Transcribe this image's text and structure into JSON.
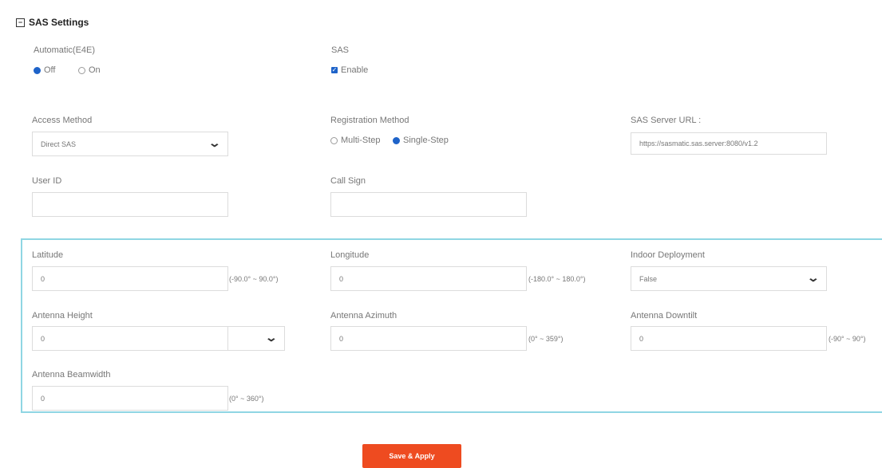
{
  "section": {
    "title": "SAS Settings"
  },
  "automatic": {
    "label": "Automatic(E4E)",
    "off": "Off",
    "on": "On",
    "selected": "Off"
  },
  "sas": {
    "label": "SAS",
    "enable_label": "Enable",
    "checked": true
  },
  "access_method": {
    "label": "Access Method",
    "value": "Direct SAS"
  },
  "registration_method": {
    "label": "Registration Method",
    "multi": "Multi-Step",
    "single": "Single-Step",
    "selected": "Single-Step"
  },
  "sas_server_url": {
    "label": "SAS Server URL :",
    "value": "https://sasmatic.sas.server:8080/v1.2"
  },
  "user_id": {
    "label": "User ID",
    "value": ""
  },
  "call_sign": {
    "label": "Call Sign",
    "value": ""
  },
  "latitude": {
    "label": "Latitude",
    "value": "0",
    "range": "(-90.0° ~ 90.0°)"
  },
  "longitude": {
    "label": "Longitude",
    "value": "0",
    "range": "(-180.0° ~ 180.0°)"
  },
  "indoor_deployment": {
    "label": "Indoor Deployment",
    "value": "False"
  },
  "antenna_height": {
    "label": "Antenna Height",
    "value": "0",
    "unit": ""
  },
  "antenna_azimuth": {
    "label": "Antenna Azimuth",
    "value": "0",
    "range": "(0° ~ 359°)"
  },
  "antenna_downtilt": {
    "label": "Antenna Downtilt",
    "value": "0",
    "range": "(-90° ~ 90°)"
  },
  "antenna_beamwidth": {
    "label": "Antenna Beamwidth",
    "value": "0",
    "range": "(0° ~ 360°)"
  },
  "actions": {
    "save_label": "Save & Apply"
  },
  "colors": {
    "accent": "#1e63c9",
    "save_button": "#ee4b20",
    "panel_border": "#8fd6e3"
  }
}
